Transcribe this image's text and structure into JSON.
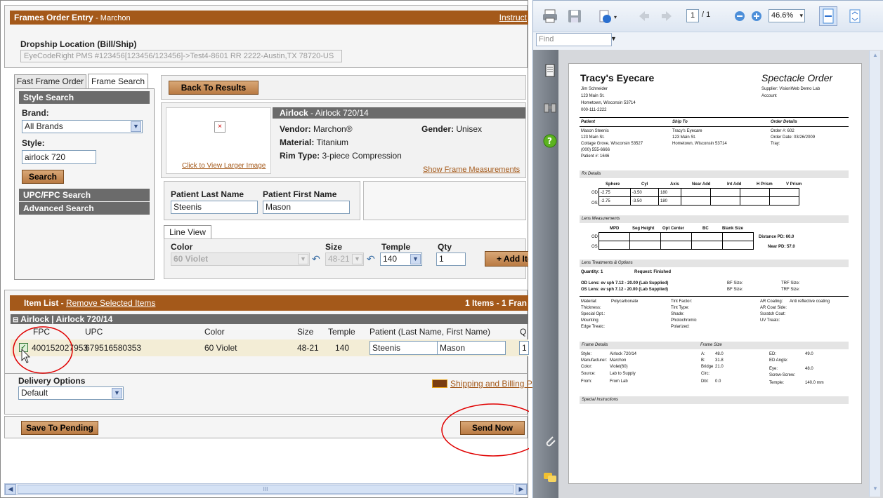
{
  "left": {
    "title": "Frames Order Entry",
    "subtitle": "- Marchon",
    "instructions": "Instruct",
    "dropship_label": "Dropship Location (Bill/Ship)",
    "dropship_value": "EyeCodeRight PMS #123456[123456/123456]->Test4-8601 RR 2222-Austin,TX 78720-US",
    "tabs": [
      "Fast Frame Order",
      "Frame Search"
    ],
    "style_search": "Style Search",
    "brand_label": "Brand:",
    "brand_value": "All Brands",
    "style_label": "Style:",
    "style_value": "airlock 720",
    "search_btn": "Search",
    "upc_search": "UPC/FPC Search",
    "advanced_search": "Advanced Search",
    "back_btn": "Back To Results",
    "frame_title": "Airlock",
    "frame_title_rest": " - Airlock 720/14",
    "larger_image": "Click to View Larger Image",
    "vendor_label": "Vendor:",
    "vendor_value": "Marchon®",
    "gender_label": "Gender:",
    "gender_value": "Unisex",
    "material_label": "Material:",
    "material_value": "Titanium",
    "rim_label": "Rim Type:",
    "rim_value": "3-piece Compression",
    "show_measurements": "Show Frame Measurements",
    "patient_last_label": "Patient Last Name",
    "patient_first_label": "Patient First Name",
    "patient_last": "Steenis",
    "patient_first": "Mason",
    "line_view": "Line View",
    "color_label": "Color",
    "size_label": "Size",
    "temple_label": "Temple",
    "qty_label": "Qty",
    "color_value": "60 Violet",
    "size_value": "48-21",
    "temple_value": "140",
    "qty_value": "1",
    "add_item": "+ Add Ite",
    "item_list": "Item List",
    "remove_selected": "Remove Selected Items",
    "items_count": "1 Items - 1 Fran",
    "group_title": "Airlock | Airlock 720/14",
    "columns": [
      "FPC",
      "UPC",
      "Color",
      "Size",
      "Temple",
      "Patient (Last Name, First Name)",
      "Q"
    ],
    "row": {
      "fpc": "400152027953",
      "upc": "679516580353",
      "color": "60 Violet",
      "size": "48-21",
      "temple": "140",
      "last": "Steenis",
      "first": "Mason",
      "qty": "1"
    },
    "delivery_label": "Delivery Options",
    "delivery_value": "Default",
    "shipping_link": "Shipping and Billing Pol",
    "save_pending": "Save To Pending",
    "send_now": "Send Now",
    "scroll_grip": "III"
  },
  "viewer": {
    "page_value": "1",
    "page_total": "/ 1",
    "zoom": "46.6%",
    "find_placeholder": "Find"
  },
  "pdf": {
    "store": "Tracy's Eyecare",
    "doc_title": "Spectacle Order",
    "hdr_lines": [
      "Jim Schneider",
      "123 Main St.",
      "Hometown, Wisconsin 53714",
      "000-111-2222"
    ],
    "supplier": "Supplier:  VisionWeb Demo Lab",
    "account": "Account",
    "patient_h": "Patient",
    "ship_h": "Ship To",
    "details_h": "Order Details",
    "patient_lines": [
      "Mason Steenis",
      "123 Main St.",
      "Cottage Grove, Wisconsin 53527",
      "(000) 555-6666",
      "Patient #:  1646"
    ],
    "ship_lines": [
      "Tracy's Eyecare",
      "123 Main St.",
      "Hometown, Wisconsin 53714"
    ],
    "order_lines": [
      "Order #:    602",
      "Order Date:  03/26/2009",
      "Tray:"
    ],
    "rx_h": "Rx Details",
    "rx_cols": [
      "Sphere",
      "Cyl",
      "Axis",
      "Near Add",
      "Int Add",
      "H Prism",
      "V Prism"
    ],
    "rx_rows": [
      [
        "OD",
        "-2.75",
        "-3.50",
        "180"
      ],
      [
        "OS",
        "-2.75",
        "-3.50",
        "180"
      ]
    ],
    "lens_h": "Lens Measurements",
    "lens_cols": [
      "MPD",
      "Seg Height",
      "Opt Center",
      "BC",
      "Blank Size"
    ],
    "distance_pd": "Distance PD:   60.0",
    "near_pd": "Near PD:   57.0",
    "treat_h": "Lens Treatments & Options",
    "quantity": "Quantity:   1",
    "request": "Request:  Finished",
    "od_lens": "OD Lens:  ev sph 7.12 - 20.00 (Lab Supplied)",
    "os_lens": "OS Lens:  ev sph 7.12 - 20.00 (Lab Supplied)",
    "bf_size": "BF Size:",
    "trf_size": "TRF Size:",
    "mat_col1": [
      "Material:",
      "Thickness:",
      "Special Opt.:",
      "Mounting",
      "Edge Treatc:"
    ],
    "mat_val": "Polycarbonate",
    "mat_col2": [
      "Tint Factor:",
      "Tint Type:",
      "Shade:",
      "Photochromic",
      "Polarized:"
    ],
    "mat_col3": [
      "AR Coating:",
      "AR Coat Side:",
      "Scratch Coat:",
      "UV Treatc:"
    ],
    "ar_val": "Anti reflective coating",
    "frame_h": "Frame Details",
    "fsize_h": "Frame Size",
    "frame_labels": [
      "Style:",
      "Manufacturer:",
      "Color:",
      "Source:",
      "From:"
    ],
    "frame_vals": [
      "Airlock 720/14",
      "Marchon",
      "Violet(60)",
      "Lab to Supply",
      "From Lab"
    ],
    "size_labels": [
      "A:",
      "B:",
      "Bridge",
      "Circ:",
      "Dbl:"
    ],
    "size_vals": [
      "48.0",
      "31.8",
      "21.0",
      "",
      "0.0"
    ],
    "ed_labels": [
      "ED:",
      "ED Angle:",
      "Eye:",
      "Screw-Screw:",
      "Temple:"
    ],
    "ed_vals": [
      "49.0",
      "",
      "48.0",
      "",
      "140.0 mm"
    ],
    "special_h": "Special Instructions"
  },
  "colors": {
    "brand": "#a4591a",
    "header_gray": "#6b6b6b",
    "annotation": "#e00000"
  }
}
